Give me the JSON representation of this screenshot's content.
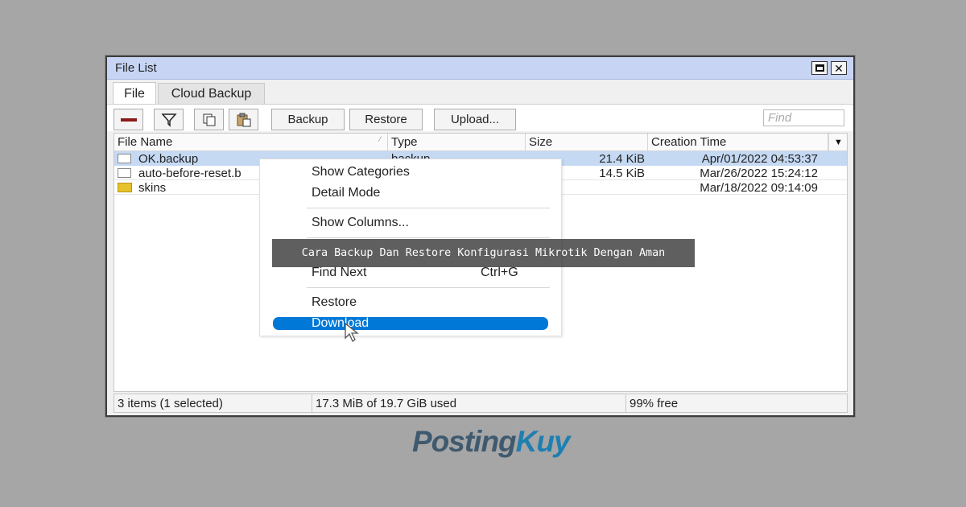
{
  "window": {
    "title": "File List"
  },
  "tabs": [
    {
      "label": "File",
      "active": true
    },
    {
      "label": "Cloud Backup",
      "active": false
    }
  ],
  "toolbar": {
    "remove_icon": "minus-icon",
    "filter_icon": "filter-icon",
    "copy_icon": "copy-icon",
    "paste_icon": "paste-icon",
    "backup_label": "Backup",
    "restore_label": "Restore",
    "upload_label": "Upload...",
    "find_placeholder": "Find"
  },
  "grid": {
    "columns": [
      "File Name",
      "Type",
      "Size",
      "Creation Time"
    ],
    "rows": [
      {
        "name": "OK.backup",
        "type": "backup",
        "size": "21.4 KiB",
        "created": "Apr/01/2022 04:53:37",
        "selected": true,
        "icon": "file-icon"
      },
      {
        "name": "auto-before-reset.b",
        "type": "",
        "size": "14.5 KiB",
        "created": "Mar/26/2022 15:24:12",
        "selected": false,
        "icon": "file-icon"
      },
      {
        "name": "skins",
        "type": "",
        "size": "",
        "created": "Mar/18/2022 09:14:09",
        "selected": false,
        "icon": "folder-icon"
      }
    ]
  },
  "status": {
    "items": "3 items (1 selected)",
    "used": "17.3 MiB of 19.7 GiB used",
    "free": "99% free"
  },
  "context_menu": {
    "show_categories": "Show Categories",
    "detail_mode": "Detail Mode",
    "show_columns": "Show Columns...",
    "find_next": "Find Next",
    "find_next_shortcut": "Ctrl+G",
    "restore": "Restore",
    "download": "Download"
  },
  "banner": {
    "text": "Cara Backup Dan Restore Konfigurasi Mikrotik Dengan Aman"
  },
  "logo": {
    "part1": "Posting",
    "part2": "Kuy"
  },
  "colors": {
    "selection": "#0078d7",
    "row_selected": "#c5d9f3",
    "titlebar": "#c7d4f3",
    "logo_dark": "#3f5a6f",
    "logo_accent": "#1f7fb0"
  }
}
